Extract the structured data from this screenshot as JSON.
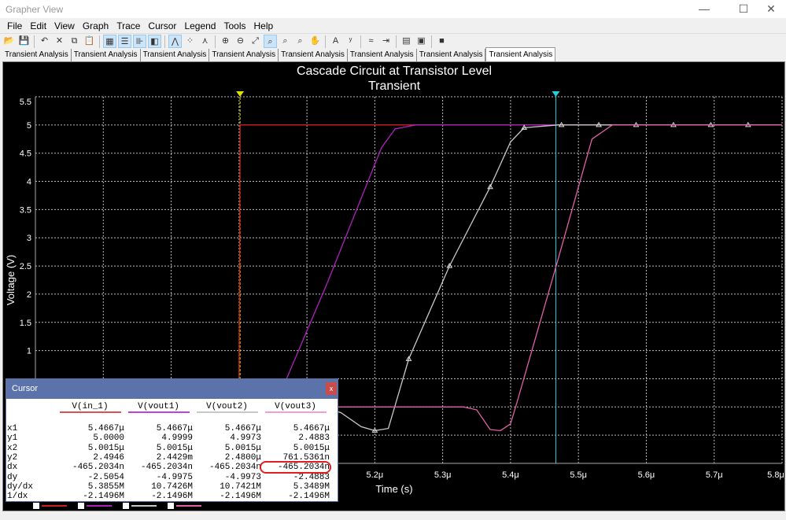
{
  "window": {
    "title": "Grapher View",
    "minimize": "—",
    "maximize": "☐",
    "close": "✕"
  },
  "menu": [
    "File",
    "Edit",
    "View",
    "Graph",
    "Trace",
    "Cursor",
    "Legend",
    "Tools",
    "Help"
  ],
  "toolbar": [
    {
      "icon": "open-icon",
      "glyph": "📂"
    },
    {
      "icon": "save-icon",
      "glyph": "💾"
    },
    {
      "sep": true
    },
    {
      "icon": "undo-icon",
      "glyph": "↶"
    },
    {
      "icon": "cut-icon",
      "glyph": "✕"
    },
    {
      "icon": "copy-icon",
      "glyph": "⧉"
    },
    {
      "icon": "paste-icon",
      "glyph": "📋"
    },
    {
      "sep": true
    },
    {
      "icon": "grid-icon",
      "glyph": "▦",
      "on": true
    },
    {
      "icon": "legend-icon",
      "glyph": "☰",
      "on": true
    },
    {
      "icon": "cursors-icon",
      "glyph": "⊪",
      "on": true
    },
    {
      "icon": "reverse-colors-icon",
      "glyph": "◧",
      "on": true
    },
    {
      "sep": true
    },
    {
      "icon": "show-lines-icon",
      "glyph": "⋀",
      "on": true
    },
    {
      "icon": "show-points-icon",
      "glyph": "⁘"
    },
    {
      "icon": "lines-points-icon",
      "glyph": "⋏"
    },
    {
      "sep": true
    },
    {
      "icon": "zoom-in-icon",
      "glyph": "⊕"
    },
    {
      "icon": "zoom-out-icon",
      "glyph": "⊖"
    },
    {
      "icon": "zoom-full-icon",
      "glyph": "⤢"
    },
    {
      "icon": "zoom-select-icon",
      "glyph": "⌕",
      "on": true
    },
    {
      "icon": "zoom-x-icon",
      "glyph": "⌕"
    },
    {
      "icon": "zoom-y-icon",
      "glyph": "⌕"
    },
    {
      "icon": "pan-hand-icon",
      "glyph": "✋"
    },
    {
      "sep": true
    },
    {
      "icon": "text-icon",
      "glyph": "A"
    },
    {
      "icon": "label-icon",
      "glyph": "ʸ"
    },
    {
      "sep": true
    },
    {
      "icon": "trace-icon",
      "glyph": "≈"
    },
    {
      "icon": "export-icon",
      "glyph": "⇥"
    },
    {
      "sep": true
    },
    {
      "icon": "page-properties-icon",
      "glyph": "▤"
    },
    {
      "icon": "properties-icon",
      "glyph": "▣"
    },
    {
      "sep": true
    },
    {
      "icon": "stop-icon",
      "glyph": "■"
    }
  ],
  "tabs": [
    "Transient Analysis",
    "Transient Analysis",
    "Transient Analysis",
    "Transient Analysis",
    "Transient Analysis",
    "Transient Analysis",
    "Transient Analysis",
    "Transient Analysis"
  ],
  "active_tab": 7,
  "chart_data": {
    "type": "line",
    "title": "Cascade Circuit at Transistor Level",
    "subtitle": "Transient",
    "xlabel": "Time (s)",
    "ylabel": "Voltage (V)",
    "xlim": [
      4.7,
      5.8
    ],
    "ylim": [
      -1.0,
      5.5
    ],
    "x_unit_suffix": "μ",
    "xticks": [
      5.2,
      5.3,
      5.4,
      5.5,
      5.6,
      5.7,
      5.8
    ],
    "xtick_labels": [
      "5.2μ",
      "5.3μ",
      "5.4μ",
      "5.5μ",
      "5.6μ",
      "5.7μ",
      "5.8μ"
    ],
    "yticks": [
      5.5,
      5.0,
      4.5,
      4.0,
      3.5,
      3.0,
      2.5,
      2.0,
      1.5,
      1.0
    ],
    "ytick_labels": [
      "5.5",
      "5.0",
      "4.5",
      "4.0",
      "3.5",
      "3.0",
      "2.5",
      "2.0",
      "1.5",
      "1.0"
    ],
    "grid": true,
    "background": "#000000",
    "series": [
      {
        "name": "V(in_1)",
        "color": "#cc2020",
        "points": [
          [
            4.7,
            0
          ],
          [
            5.0,
            0
          ],
          [
            5.0015,
            5
          ],
          [
            5.8,
            5
          ]
        ]
      },
      {
        "name": "V(vout1)",
        "color": "#b020c0",
        "points": [
          [
            4.7,
            0
          ],
          [
            5.03,
            0
          ],
          [
            5.07,
            0.5
          ],
          [
            5.13,
            2.2
          ],
          [
            5.19,
            4.0
          ],
          [
            5.21,
            4.6
          ],
          [
            5.23,
            4.93
          ],
          [
            5.26,
            5.0
          ],
          [
            5.8,
            5.0
          ]
        ]
      },
      {
        "name": "V(vout2)",
        "color": "#c8c8c8",
        "markers": true,
        "points": [
          [
            4.7,
            0
          ],
          [
            5.12,
            0
          ],
          [
            5.15,
            -0.1
          ],
          [
            5.18,
            -0.35
          ],
          [
            5.2,
            -0.42
          ],
          [
            5.22,
            -0.38
          ],
          [
            5.25,
            0.85
          ],
          [
            5.31,
            2.5
          ],
          [
            5.37,
            3.9
          ],
          [
            5.4,
            4.7
          ],
          [
            5.42,
            4.95
          ],
          [
            5.47,
            5.0
          ],
          [
            5.8,
            5.0
          ]
        ],
        "marker_x": [
          5.2,
          5.25,
          5.31,
          5.37,
          5.42,
          5.475,
          5.53,
          5.585,
          5.64,
          5.695,
          5.75
        ]
      },
      {
        "name": "V(vout3)",
        "color": "#e060a8",
        "points": [
          [
            4.7,
            0
          ],
          [
            5.33,
            0
          ],
          [
            5.35,
            -0.05
          ],
          [
            5.37,
            -0.4
          ],
          [
            5.385,
            -0.42
          ],
          [
            5.4,
            -0.3
          ],
          [
            5.41,
            0.1
          ],
          [
            5.467,
            2.49
          ],
          [
            5.52,
            4.75
          ],
          [
            5.55,
            5.0
          ],
          [
            5.8,
            5.0
          ]
        ]
      }
    ],
    "cursors": [
      {
        "x": 5.0015,
        "color": "#e0e000"
      },
      {
        "x": 5.4667,
        "color": "#20d0e0"
      }
    ]
  },
  "cursor_window": {
    "title": "Cursor",
    "close": "x",
    "columns": [
      {
        "name": "V(in_1)",
        "color": "#e05050"
      },
      {
        "name": "V(vout1)",
        "color": "#c040e0"
      },
      {
        "name": "V(vout2)",
        "color": "#c8c8c8"
      },
      {
        "name": "V(vout3)",
        "color": "#f0a0d0"
      }
    ],
    "rows": [
      {
        "label": "x1",
        "values": [
          "5.4667μ",
          "5.4667μ",
          "5.4667μ",
          "5.4667μ"
        ]
      },
      {
        "label": "y1",
        "values": [
          "5.0000",
          "4.9999",
          "4.9973",
          "2.4883"
        ]
      },
      {
        "label": "x2",
        "values": [
          "5.0015μ",
          "5.0015μ",
          "5.0015μ",
          "5.0015μ"
        ]
      },
      {
        "label": "y2",
        "values": [
          "2.4946",
          "2.4429m",
          "2.4800μ",
          "761.5361n"
        ]
      },
      {
        "label": "dx",
        "values": [
          "-465.2034n",
          "-465.2034n",
          "-465.2034n",
          "-465.2034n"
        ]
      },
      {
        "label": "dy",
        "values": [
          "-2.5054",
          "-4.9975",
          "-4.9973",
          "-2.4883"
        ]
      },
      {
        "label": "dy/dx",
        "values": [
          "5.3855M",
          "10.7426M",
          "10.7421M",
          "5.3489M"
        ]
      },
      {
        "label": "1/dx",
        "values": [
          "-2.1496M",
          "-2.1496M",
          "-2.1496M",
          "-2.1496M"
        ]
      }
    ],
    "highlight": {
      "row": 4,
      "col": 3,
      "color": "#e02020"
    }
  }
}
